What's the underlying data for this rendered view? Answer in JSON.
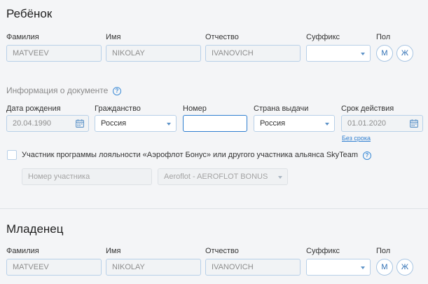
{
  "child": {
    "title": "Ребёнок",
    "labels": {
      "last_name": "Фамилия",
      "first_name": "Имя",
      "middle_name": "Отчество",
      "suffix": "Суффикс",
      "gender": "Пол"
    },
    "last_name": "MATVEEV",
    "first_name": "NIKOLAY",
    "middle_name": "IVANOVICH",
    "suffix": "",
    "gender_male": "М",
    "gender_female": "Ж",
    "document": {
      "title": "Информация о документе",
      "labels": {
        "dob": "Дата рождения",
        "citizenship": "Гражданство",
        "number": "Номер",
        "country": "Страна выдачи",
        "expiry": "Срок действия"
      },
      "dob": "20.04.1990",
      "citizenship": "Россия",
      "number": "",
      "country": "Россия",
      "expiry": "01.01.2020",
      "no_expiry_link": "Без срока"
    },
    "loyalty": {
      "label": "Участник программы лояльности «Аэрофлот Бонус» или другого участника альянса SkyTeam",
      "member_placeholder": "Номер участника",
      "program": "Aeroflot - AEROFLOT BONUS"
    }
  },
  "infant": {
    "title": "Младенец",
    "labels": {
      "last_name": "Фамилия",
      "first_name": "Имя",
      "middle_name": "Отчество",
      "suffix": "Суффикс",
      "gender": "Пол"
    },
    "last_name": "MATVEEV",
    "first_name": "NIKOLAY",
    "middle_name": "IVANOVICH",
    "suffix": "",
    "gender_male": "М",
    "gender_female": "Ж"
  },
  "help_glyph": "?",
  "icons": {
    "help": "question-circle-icon",
    "calendar": "calendar-icon",
    "dropdown": "chevron-down-icon"
  },
  "colors": {
    "accent": "#2f7fd0",
    "field_border": "#b8d0e8",
    "background": "#f4f5f7"
  }
}
